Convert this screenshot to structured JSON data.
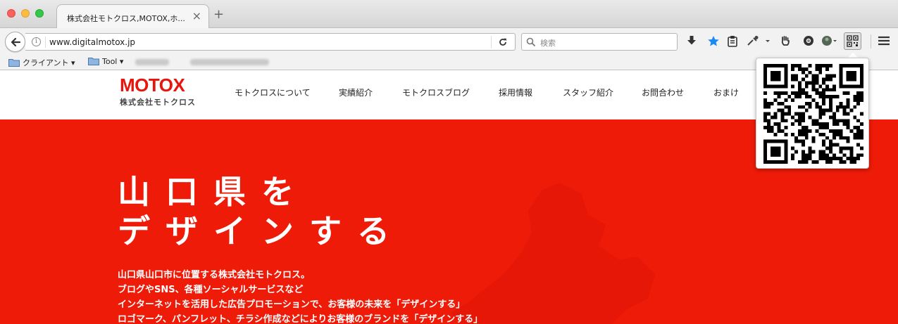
{
  "browser": {
    "tab_title": "株式会社モトクロス,MOTOX,ホ...",
    "tab_close": "×",
    "new_tab": "+",
    "url": "www.digitalmotox.jp",
    "search_placeholder": "検索"
  },
  "bookmarks": {
    "items": [
      {
        "label": "クライアント ▾"
      },
      {
        "label": "Tool ▾"
      }
    ]
  },
  "site": {
    "logo": "MOTOX",
    "logo_sub": "株式会社モトクロス",
    "nav": [
      "モトクロスについて",
      "実績紹介",
      "モトクロスブログ",
      "採用情報",
      "スタッフ紹介",
      "お問合わせ",
      "おまけ"
    ],
    "hero": {
      "headline_1": "山口県を",
      "headline_2": "デザインする",
      "body": [
        "山口県山口市に位置する株式会社モトクロス。",
        "ブログやSNS、各種ソーシャルサービスなど",
        "インターネットを活用した広告プロモーションで、お客様の未来を「デザインする」",
        "ロゴマーク、パンフレット、チラシ作成などによりお客様のブランドを「デザインする」"
      ]
    }
  },
  "colors": {
    "brand_red": "#ee1b08",
    "logo_red": "#e8150d",
    "bookmark_star": "#1a8bf5"
  },
  "icons": {
    "back": "arrow-left",
    "info": "info-circle",
    "reload": "reload",
    "search": "magnifier",
    "download": "download-arrow",
    "bookmark": "star",
    "reader": "clipboard",
    "pipette": "pipette",
    "hand": "hand",
    "chrome": "chrome",
    "avatar": "profile",
    "qr": "qr-code",
    "menu": "hamburger"
  }
}
